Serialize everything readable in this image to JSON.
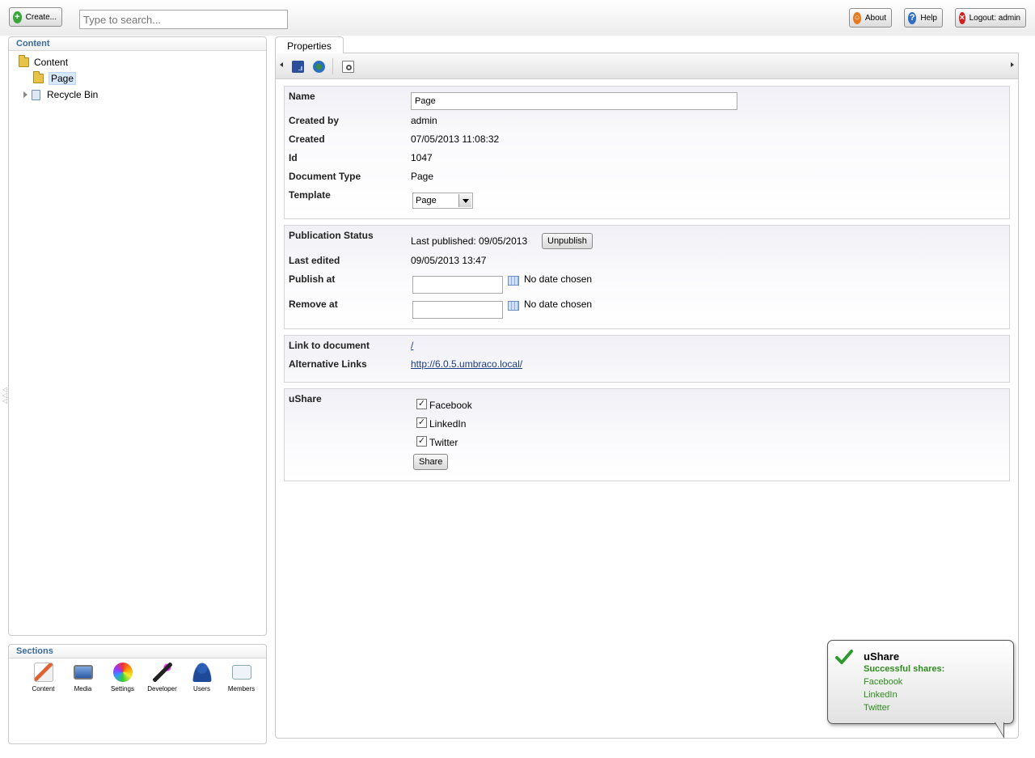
{
  "topbar": {
    "create_label": "Create...",
    "search_placeholder": "Type to search...",
    "about_label": "About",
    "help_label": "Help",
    "logout_label": "Logout: admin"
  },
  "content_panel": {
    "title": "Content",
    "tree": [
      {
        "label": "Content",
        "icon": "folder-icon"
      },
      {
        "label": "Page",
        "icon": "folder-icon",
        "selected": true
      },
      {
        "label": "Recycle Bin",
        "icon": "recycle-bin-icon"
      }
    ]
  },
  "sections_panel": {
    "title": "Sections",
    "items": [
      {
        "label": "Content",
        "icon": "content-icon"
      },
      {
        "label": "Media",
        "icon": "media-icon"
      },
      {
        "label": "Settings",
        "icon": "settings-icon"
      },
      {
        "label": "Developer",
        "icon": "developer-icon"
      },
      {
        "label": "Users",
        "icon": "users-icon"
      },
      {
        "label": "Members",
        "icon": "members-icon"
      }
    ]
  },
  "main": {
    "tab_label": "Properties",
    "info": {
      "name_label": "Name",
      "name_value": "Page",
      "created_by_label": "Created by",
      "created_by_value": "admin",
      "created_label": "Created",
      "created_value": "07/05/2013 11:08:32",
      "id_label": "Id",
      "id_value": "1047",
      "doctype_label": "Document Type",
      "doctype_value": "Page",
      "template_label": "Template",
      "template_value": "Page"
    },
    "publication": {
      "status_label": "Publication Status",
      "status_value": "Last published: 09/05/2013",
      "unpublish_label": "Unpublish",
      "last_edited_label": "Last edited",
      "last_edited_value": "09/05/2013 13:47",
      "publish_at_label": "Publish at",
      "publish_at_status": "No date chosen",
      "remove_at_label": "Remove at",
      "remove_at_status": "No date chosen"
    },
    "links": {
      "link_label": "Link to document",
      "link_value": "/",
      "alt_label": "Alternative Links",
      "alt_value": "http://6.0.5.umbraco.local/"
    },
    "ushare": {
      "label": "uShare",
      "options": [
        "Facebook",
        "LinkedIn",
        "Twitter"
      ],
      "share_label": "Share"
    }
  },
  "notification": {
    "title": "uShare",
    "subtitle": "Successful shares:",
    "items": [
      "Facebook",
      "LinkedIn",
      "Twitter"
    ]
  },
  "colors": {
    "panel_title": "#3a6b9c",
    "success_green": "#2e8b1e",
    "link_blue": "#1c3c86"
  }
}
